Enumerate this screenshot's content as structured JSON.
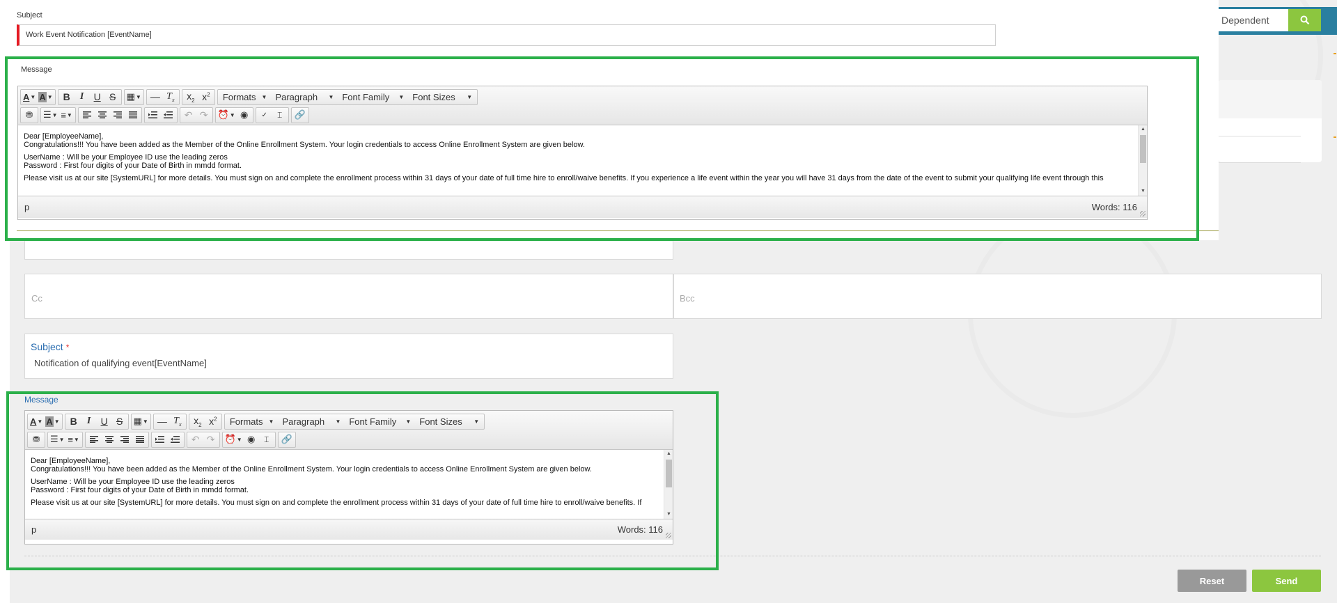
{
  "search": {
    "value": "Dependent",
    "button_icon": "search-icon"
  },
  "overlay": {
    "subject_label": "Subject",
    "subject_value": "Work Event Notification [EventName]",
    "message_label": "Message"
  },
  "toolbar": {
    "formats": "Formats",
    "paragraph": "Paragraph",
    "font_family": "Font Family",
    "font_sizes": "Font Sizes"
  },
  "editor_top": {
    "content": {
      "line1": "Dear [EmployeeName],",
      "line2": "Congratulations!!! You have been added as the Member of the Online Enrollment System. Your login credentials to access Online Enrollment System are given below.",
      "line3": "UserName : Will be your Employee ID use the leading zeros",
      "line4": "Password : First four digits of your Date of Birth in mmdd format.",
      "line5": "Please visit us at our site [SystemURL] for more details. You must sign on and complete the enrollment process within 31 days of your date of full time hire to enroll/waive benefits. If you experience a life event within the year you will have 31 days from the date of the event to submit your qualifying life event through this"
    },
    "status_path": "p",
    "word_count": "Words: 116"
  },
  "form": {
    "cc_placeholder": "Cc",
    "bcc_placeholder": "Bcc",
    "subject_label": "Subject",
    "required_mark": "*",
    "subject_value": "Notification of qualifying event[EventName]",
    "message_label": "Message"
  },
  "editor_bottom": {
    "content": {
      "line1": "Dear [EmployeeName],",
      "line2": "Congratulations!!! You have been added as the Member of the Online Enrollment System. Your login credentials to access Online Enrollment System are given below.",
      "line3": "UserName : Will be your Employee ID use the leading zeros",
      "line4": "Password : First four digits of your Date of Birth in mmdd format.",
      "line5": "Please visit us at our site [SystemURL] for more details. You must sign on and complete the enrollment process within 31 days of your date of full time hire to enroll/waive benefits. If"
    },
    "status_path": "p",
    "word_count": "Words: 116"
  },
  "actions": {
    "reset": "Reset",
    "send": "Send"
  },
  "colors": {
    "highlight": "#2bb04a",
    "send_button": "#8cc63f",
    "reset_button": "#999999",
    "search_button": "#8cc63f",
    "header_bar": "#2a7fa0",
    "required_border": "#e41b23",
    "label_blue": "#2a6db0"
  }
}
